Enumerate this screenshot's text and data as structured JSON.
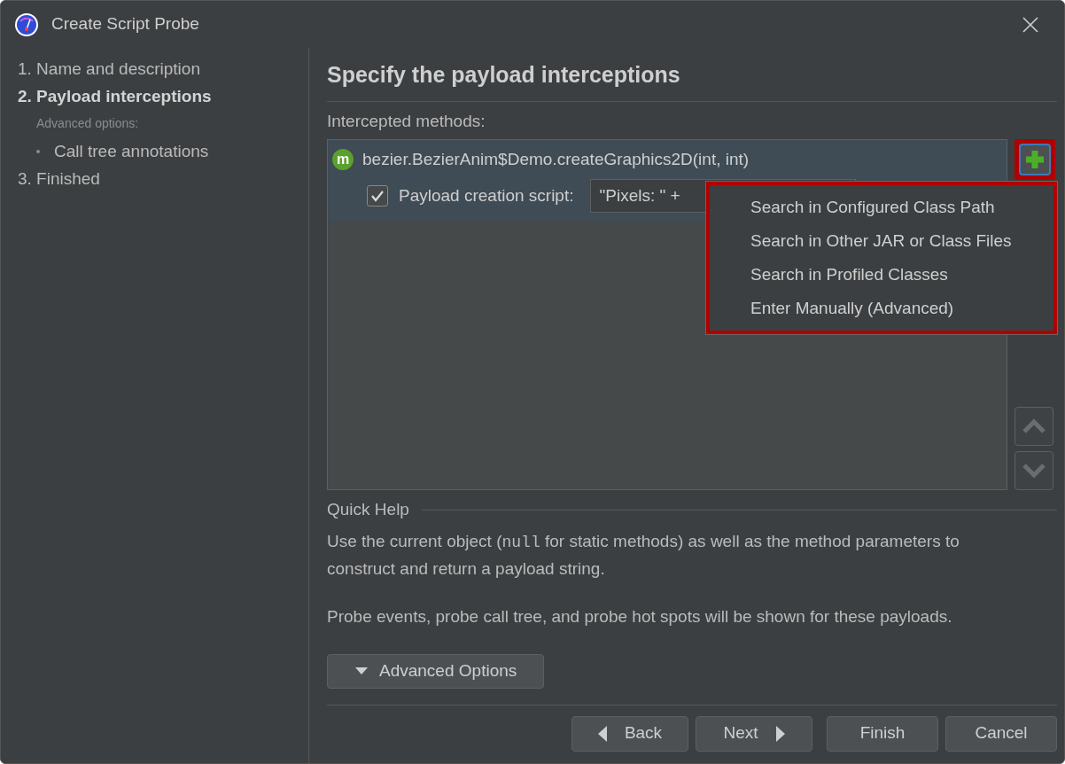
{
  "window": {
    "title": "Create Script Probe"
  },
  "steps": [
    {
      "kind": "step",
      "label": "1. Name and description",
      "selected": false
    },
    {
      "kind": "step",
      "label": "2. Payload interceptions",
      "selected": true
    },
    {
      "kind": "subheading",
      "label": "Advanced options:"
    },
    {
      "kind": "bullet",
      "label": "Call tree annotations",
      "selected": false
    },
    {
      "kind": "step",
      "label": "3. Finished",
      "selected": false
    }
  ],
  "page": {
    "heading": "Specify the payload interceptions",
    "list_label": "Intercepted methods:"
  },
  "methods": [
    {
      "badge": "m",
      "name": "bezier.BezierAnim$Demo.createGraphics2D(int, int)",
      "selected": true,
      "script_checked": true,
      "script_label": "Payload creation script:",
      "script_value": "\"Pixels: \" +"
    }
  ],
  "add_menu": {
    "open": true,
    "items": [
      "Search in Configured Class Path",
      "Search in Other JAR or Class Files",
      "Search in Profiled Classes",
      "Enter Manually (Advanced)"
    ]
  },
  "highlights": true,
  "quick_help": {
    "title": "Quick Help",
    "paragraph_1": {
      "before": "Use the current object (",
      "code": "null",
      "after": " for static methods) as well as the method parameters to construct and return a payload string."
    },
    "paragraph_2": "Probe events, probe call tree, and probe hot spots will be shown for these payloads."
  },
  "advanced_button": {
    "label": "Advanced Options",
    "expanded": false
  },
  "buttons": {
    "back": "Back",
    "next": "Next",
    "finish": "Finish",
    "cancel": "Cancel"
  }
}
